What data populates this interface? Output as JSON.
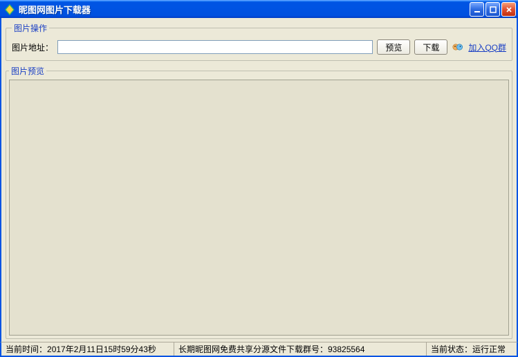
{
  "window": {
    "title": "昵图网图片下载器"
  },
  "groups": {
    "operations_legend": "图片操作",
    "preview_legend": "图片预览"
  },
  "form": {
    "url_label": "图片地址：",
    "url_value": "",
    "preview_btn": "预览",
    "download_btn": "下载",
    "join_qq_link": "加入QQ群"
  },
  "statusbar": {
    "time_label": "当前时间：",
    "time_value": "2017年2月11日15时59分43秒",
    "share_text": "长期昵图网免费共享分源文件下载群号：93825564",
    "state_label": "当前状态：",
    "state_value": "运行正常"
  }
}
